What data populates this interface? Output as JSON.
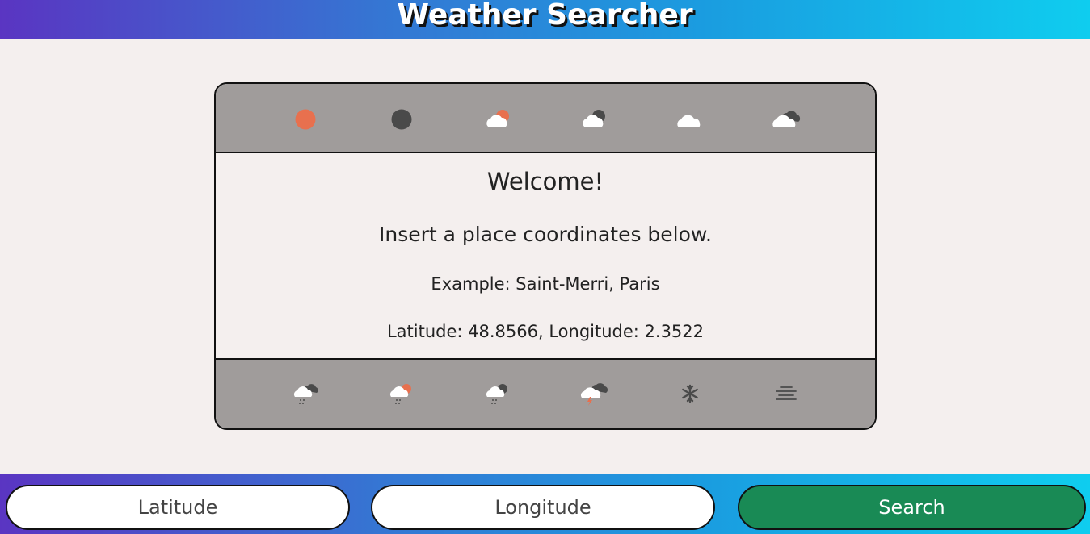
{
  "header": {
    "title": "Weather Searcher"
  },
  "card": {
    "welcome": "Welcome!",
    "instruction": "Insert a place coordinates below.",
    "example": "Example: Saint-Merri, Paris",
    "example_coords": "Latitude: 48.8566, Longitude: 2.3522",
    "top_icons": [
      "clear-day-icon",
      "clear-night-icon",
      "partly-cloudy-day-icon",
      "partly-cloudy-night-icon",
      "cloudy-icon",
      "overcast-icon"
    ],
    "bottom_icons": [
      "rain-icon",
      "rain-day-icon",
      "rain-night-icon",
      "thunderstorm-icon",
      "snow-icon",
      "fog-icon"
    ]
  },
  "form": {
    "latitude_placeholder": "Latitude",
    "longitude_placeholder": "Longitude",
    "search_label": "Search"
  },
  "colors": {
    "sun": "#e8704e",
    "moon": "#4a4a4a",
    "cloud": "#ffffff",
    "search_button": "#198a55"
  }
}
